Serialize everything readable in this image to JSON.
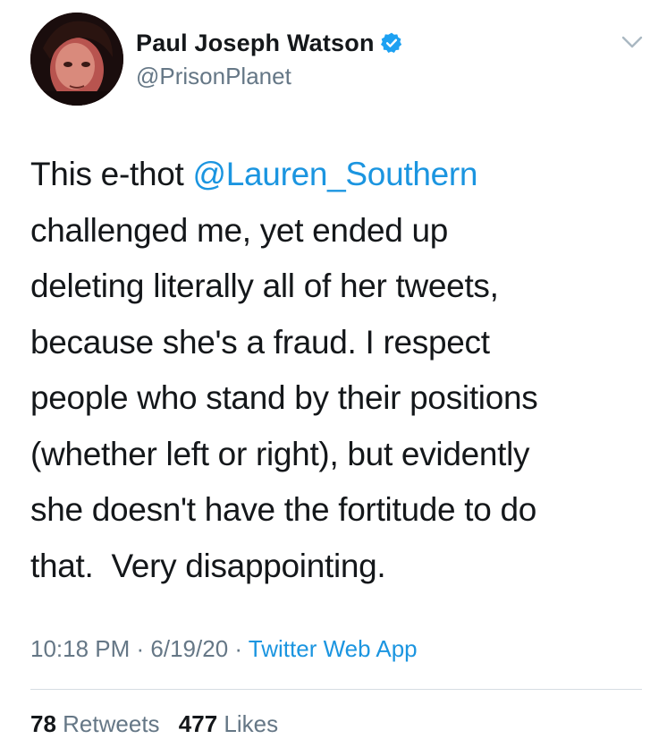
{
  "author": {
    "display_name": "Paul Joseph Watson",
    "handle": "@PrisonPlanet",
    "verified": true,
    "avatar_icon": "profile-photo"
  },
  "tweet": {
    "lines": [
      {
        "before": "This e-thot ",
        "mention": "@Lauren_Southern",
        "after": ""
      },
      {
        "before": "challenged me, yet ended up",
        "mention": "",
        "after": ""
      },
      {
        "before": "deleting literally all of her tweets,",
        "mention": "",
        "after": ""
      },
      {
        "before": "because she's a fraud. I respect",
        "mention": "",
        "after": ""
      },
      {
        "before": "people who stand by their positions",
        "mention": "",
        "after": ""
      },
      {
        "before": "(whether left or right), but evidently",
        "mention": "",
        "after": ""
      },
      {
        "before": "she doesn't have the fortitude to do",
        "mention": "",
        "after": ""
      },
      {
        "before": "that.  Very disappointing.",
        "mention": "",
        "after": ""
      }
    ]
  },
  "meta": {
    "time": "10:18 PM",
    "separator": " · ",
    "date": "6/19/20",
    "source": "Twitter Web App"
  },
  "stats": {
    "retweets_count": "78",
    "retweets_label": "Retweets",
    "likes_count": "477",
    "likes_label": "Likes"
  },
  "colors": {
    "link": "#1b95e0",
    "secondary_text": "#657786",
    "primary_text": "#14171a",
    "verified_badge": "#1da1f2"
  },
  "icons": {
    "verified": "verified-badge-icon",
    "menu": "chevron-down-icon"
  }
}
